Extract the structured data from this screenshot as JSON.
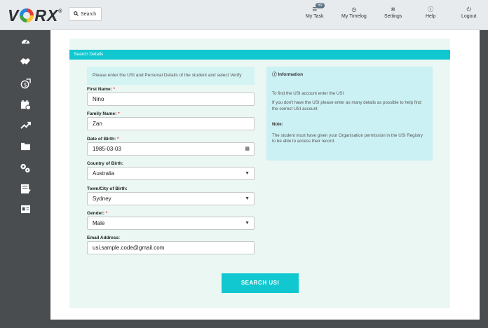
{
  "header": {
    "logo_text": "VORX",
    "search_label": "Search",
    "nav": [
      {
        "label": "My Task",
        "icon": "list-icon",
        "badge": "59"
      },
      {
        "label": "My Timelog",
        "icon": "clock-icon"
      },
      {
        "label": "Settings",
        "icon": "gear-icon"
      },
      {
        "label": "Help",
        "icon": "info-icon"
      },
      {
        "label": "Logout",
        "icon": "power-icon"
      }
    ]
  },
  "sidebar": {
    "icons": [
      "dashboard-icon",
      "handshake-icon",
      "money-icon",
      "calendar-check-icon",
      "trending-up-icon",
      "folder-icon",
      "cogs-icon",
      "checklist-icon",
      "id-card-icon"
    ]
  },
  "form": {
    "header": "Search Details",
    "instructions": "Please enter the USI and Personal Details of the student and select Verify",
    "fields": {
      "first_name": {
        "label": "First Name:",
        "value": "Nino",
        "required": "*"
      },
      "family_name": {
        "label": "Family Name:",
        "value": "Zan",
        "required": "*"
      },
      "dob": {
        "label": "Date of Birth:",
        "value": "1985-03-03",
        "required": "*"
      },
      "country": {
        "label": "Country of Birth:",
        "value": "Australia"
      },
      "town": {
        "label": "Town/City of Birth:",
        "value": "Sydney"
      },
      "gender": {
        "label": "Gender:",
        "value": "Male",
        "required": "*"
      },
      "email": {
        "label": "Email Address:",
        "value": "usi.sample.code@gmail.com"
      }
    },
    "submit_label": "SEARCH USI"
  },
  "info": {
    "title": "Information",
    "line1": "To find the USI account enter the USI",
    "line2": "If you don't have the USI please enter as many details as possible to help find the correct USI account",
    "note_title": "Note:",
    "note_text": "The student must have given your Organisation permission in the USI Registry to be able to access their record."
  },
  "colors": {
    "accent": "#12c8d0",
    "sidebar": "#4a4d50",
    "panel": "#eaf7f3"
  }
}
